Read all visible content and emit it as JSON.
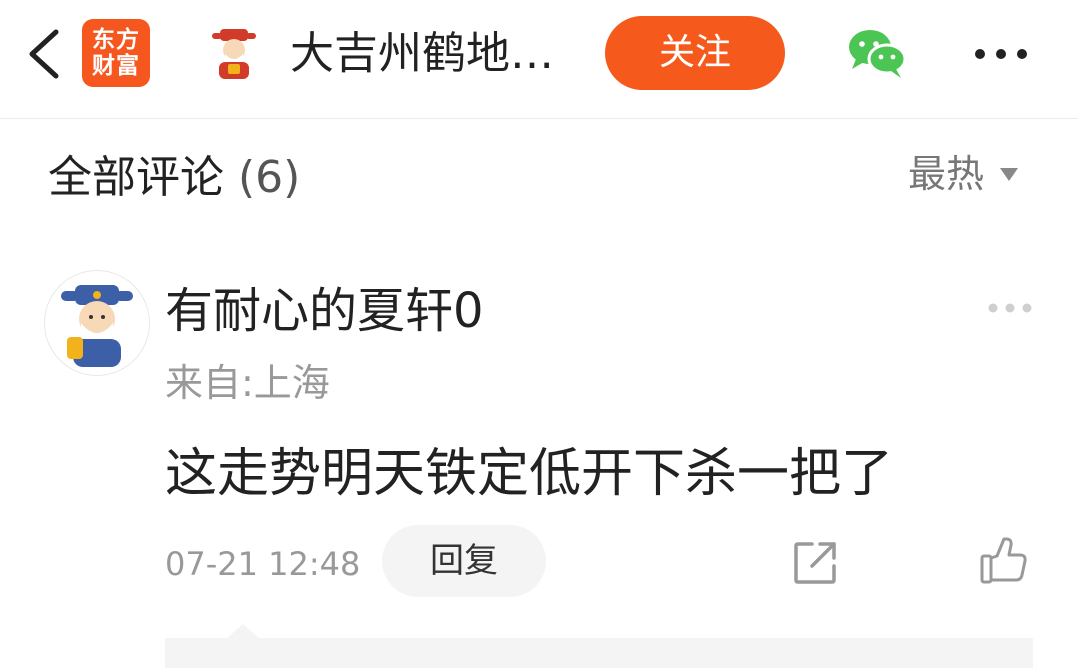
{
  "header": {
    "app_logo_line1": "东方",
    "app_logo_line2": "财富",
    "title": "大吉州鹤地…",
    "follow_label": "关注",
    "brand_color": "#f55a1c",
    "icons": [
      "back-chevron-icon",
      "fortune-god-avatar",
      "wechat-icon",
      "more-icon"
    ]
  },
  "comments_section": {
    "title": "全部评论",
    "count": "(6)",
    "sort_label": "最热"
  },
  "comment": {
    "username": "有耐心的夏轩0",
    "location": "来自:上海",
    "text": "这走势明天铁定低开下杀一把了",
    "time": "07-21 12:48",
    "reply_label": "回复",
    "icons": [
      "share-icon",
      "thumbs-up-icon",
      "more-dots-icon"
    ]
  }
}
